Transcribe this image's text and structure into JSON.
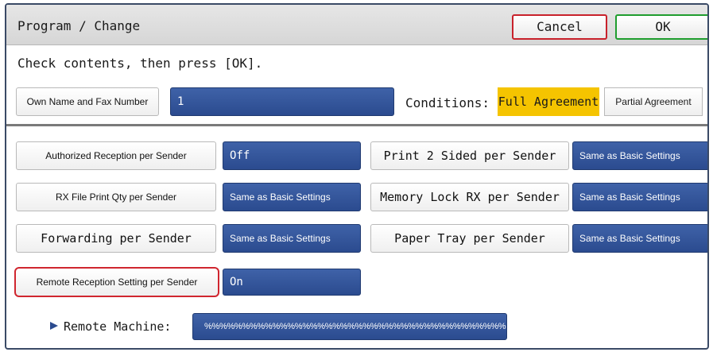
{
  "header": {
    "title": "Program / Change",
    "cancel_label": "Cancel",
    "ok_label": "OK",
    "instruction": "Check contents, then press [OK]."
  },
  "own_name": {
    "button_label": "Own Name and Fax Number",
    "value": "1"
  },
  "conditions": {
    "label": "Conditions:",
    "options": [
      "Full Agreement",
      "Partial Agreement"
    ],
    "selected": "Full Agreement"
  },
  "settings": {
    "authorized_reception": {
      "label": "Authorized Reception per Sender",
      "value": "Off"
    },
    "print_2_sided": {
      "label": "Print 2 Sided per Sender",
      "value": "Same as Basic Settings"
    },
    "rx_file_print_qty": {
      "label": "RX File Print Qty per Sender",
      "value": "Same as Basic Settings"
    },
    "memory_lock_rx": {
      "label": "Memory Lock RX per Sender",
      "value": "Same as Basic Settings"
    },
    "forwarding": {
      "label": "Forwarding per Sender",
      "value": "Same as Basic Settings"
    },
    "paper_tray": {
      "label": "Paper Tray per Sender",
      "value": "Same as Basic Settings"
    },
    "remote_reception": {
      "label": "Remote Reception Setting per Sender",
      "value": "On"
    }
  },
  "remote_machine": {
    "label": "Remote Machine:",
    "value": "%%%%%%%%%%%%%%%%%%%%%%%%%%%%%%%%%%%%%%%%"
  },
  "colors": {
    "selection_blue": "#2b4b8f",
    "highlight_yellow": "#f5c400",
    "cancel_red": "#c8212b",
    "ok_green": "#1f9d2e"
  },
  "icons": {
    "arrow": "play-arrow-icon"
  }
}
